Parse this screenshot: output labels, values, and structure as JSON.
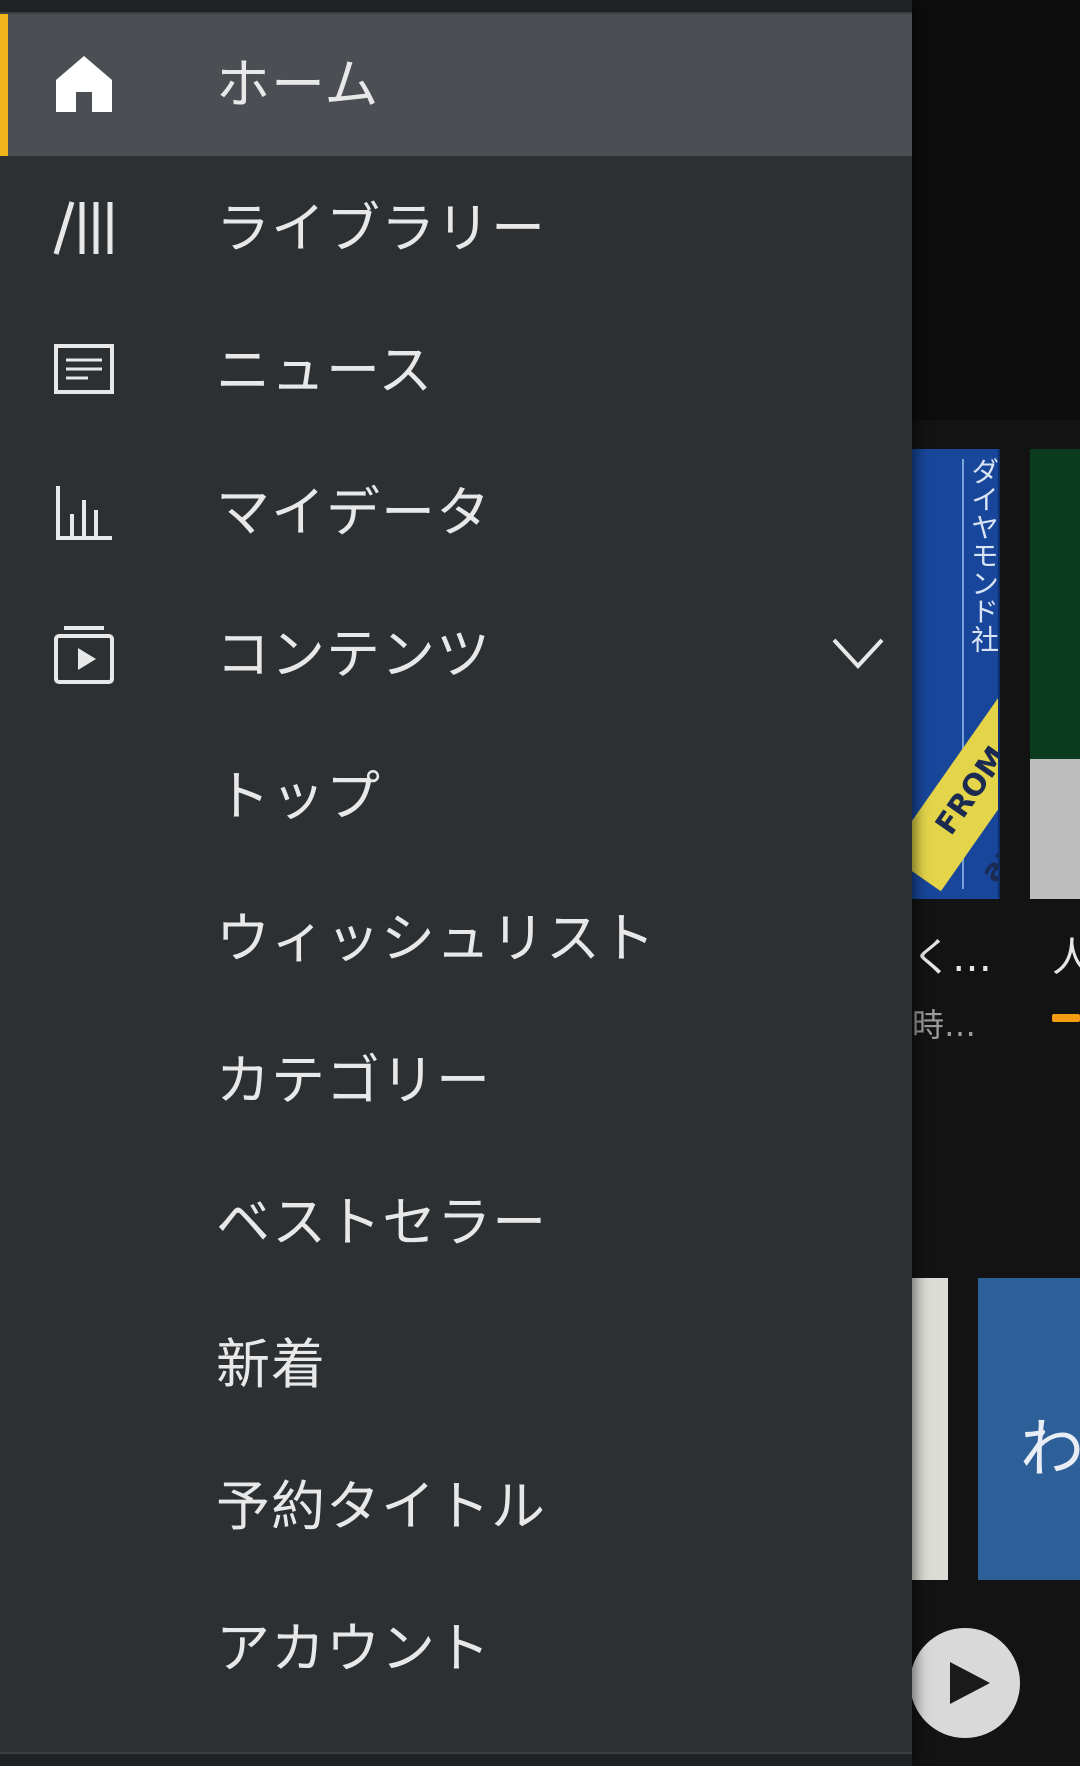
{
  "drawer": {
    "accent_color": "#f3b31b",
    "items": [
      {
        "label": "ホーム",
        "icon": "home-icon",
        "active": true
      },
      {
        "label": "ライブラリー",
        "icon": "library-icon"
      },
      {
        "label": "ニュース",
        "icon": "news-icon"
      },
      {
        "label": "マイデータ",
        "icon": "stats-icon"
      },
      {
        "label": "コンテンツ",
        "icon": "content-play-icon",
        "expanded": true
      },
      {
        "label": "トップ"
      },
      {
        "label": "ウィッシュリスト"
      },
      {
        "label": "カテゴリー"
      },
      {
        "label": "ベストセラー"
      },
      {
        "label": "新着"
      },
      {
        "label": "予約タイトル"
      },
      {
        "label": "アカウント"
      }
    ]
  },
  "background": {
    "cover1_publisher": "ダイヤモンド社",
    "cover1_badge": "FROM audible",
    "title_peek_1": "く…",
    "title_peek_2": "人",
    "sub_peek": "時…",
    "cover4_glyph": "わ",
    "progress_color": "#f39c12"
  }
}
